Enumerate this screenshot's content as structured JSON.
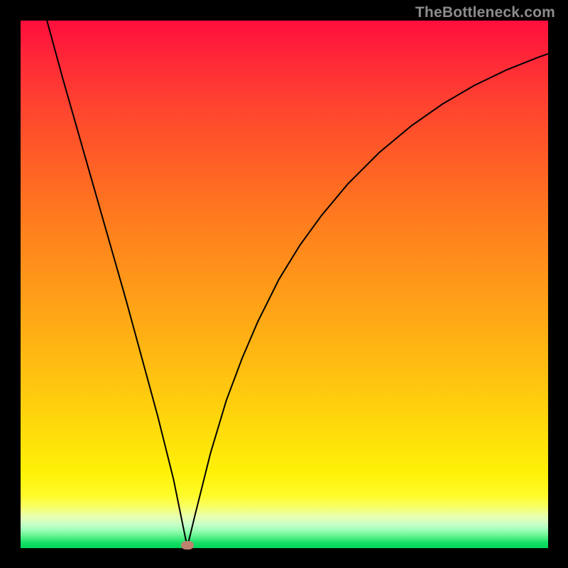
{
  "watermark": "TheBottleneck.com",
  "chart_data": {
    "type": "line",
    "title": "",
    "xlabel": "",
    "ylabel": "",
    "xlim": [
      0,
      100
    ],
    "ylim": [
      0,
      100
    ],
    "series": [
      {
        "name": "bottleneck-curve",
        "x": [
          5,
          8,
          11,
          14,
          17,
          20,
          23,
          26,
          29,
          31.6,
          33,
          36,
          39,
          42,
          45,
          49,
          53,
          57,
          62,
          68,
          74,
          80,
          86,
          92,
          98,
          100
        ],
        "y": [
          100,
          89,
          78.5,
          68,
          57.5,
          47,
          36,
          25,
          13,
          0.2,
          6,
          18,
          28,
          36,
          43,
          51,
          57.5,
          63,
          69,
          75,
          80,
          84.2,
          87.7,
          90.6,
          93,
          93.7
        ]
      }
    ],
    "marker": {
      "x": 31.6,
      "y": 0.6,
      "color": "#bd836f"
    },
    "background_gradient": {
      "top": "#ff0f3c",
      "mid_upper": "#ff941a",
      "mid_lower": "#ffe20a",
      "bottom": "#00d45a"
    },
    "frame_color": "#000000",
    "curve_color": "#000000"
  }
}
